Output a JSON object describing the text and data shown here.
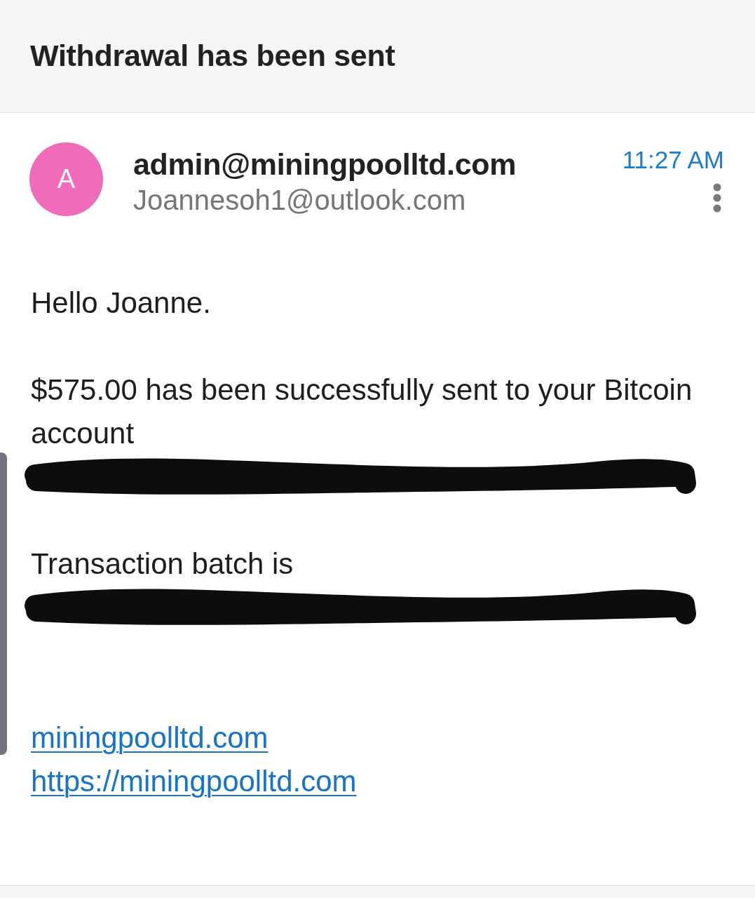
{
  "header": {
    "title": "Withdrawal has been sent"
  },
  "message": {
    "avatar_letter": "A",
    "sender": "admin@miningpoolltd.com",
    "recipient": "Joannesoh1@outlook.com",
    "time": "11:27 AM"
  },
  "body": [
    {
      "lines": [
        {
          "kind": "text",
          "text": "Hello Joanne."
        }
      ]
    },
    {
      "lines": [
        {
          "kind": "text",
          "text": "$575.00 has been successfully sent to your Bitcoin account"
        },
        {
          "kind": "redacted"
        }
      ]
    },
    {
      "lines": [
        {
          "kind": "text",
          "text": "Transaction batch is"
        },
        {
          "kind": "redacted"
        }
      ]
    },
    {
      "lines": [
        {
          "kind": "link",
          "text": "miningpoolltd.com"
        },
        {
          "kind": "link",
          "text": "https://miningpoolltd.com"
        }
      ]
    }
  ]
}
